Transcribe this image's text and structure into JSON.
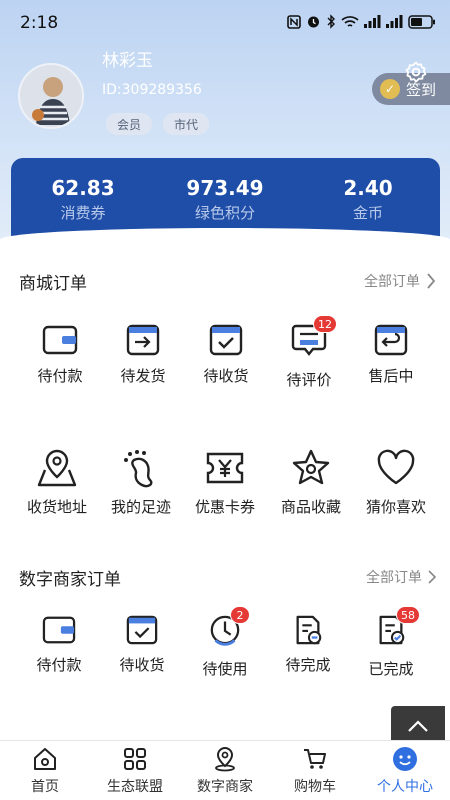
{
  "status_bar": {
    "time": "2:18"
  },
  "profile": {
    "name": "林彩玉",
    "id_text": "ID:309289356",
    "tags": [
      "会员",
      "市代"
    ],
    "signin_label": "签到"
  },
  "stats": [
    {
      "value": "62.83",
      "label": "消费券"
    },
    {
      "value": "973.49",
      "label": "绿色积分"
    },
    {
      "value": "2.40",
      "label": "金币"
    }
  ],
  "mall_orders": {
    "title": "商城订单",
    "more_label": "全部订单",
    "items": [
      {
        "label": "待付款",
        "icon": "wallet-icon"
      },
      {
        "label": "待发货",
        "icon": "ship-box-icon"
      },
      {
        "label": "待收货",
        "icon": "receive-box-icon"
      },
      {
        "label": "待评价",
        "icon": "comment-icon",
        "badge": "12"
      },
      {
        "label": "售后中",
        "icon": "return-box-icon"
      }
    ]
  },
  "services": {
    "items": [
      {
        "label": "收货地址",
        "icon": "map-pin-icon"
      },
      {
        "label": "我的足迹",
        "icon": "footprint-icon"
      },
      {
        "label": "优惠卡券",
        "icon": "coupon-icon"
      },
      {
        "label": "商品收藏",
        "icon": "star-icon"
      },
      {
        "label": "猜你喜欢",
        "icon": "heart-icon"
      }
    ]
  },
  "merchant_orders": {
    "title": "数字商家订单",
    "more_label": "全部订单",
    "items": [
      {
        "label": "待付款",
        "icon": "wallet-icon"
      },
      {
        "label": "待收货",
        "icon": "receive-box-icon"
      },
      {
        "label": "待使用",
        "icon": "clock-icon",
        "badge": "2"
      },
      {
        "label": "待完成",
        "icon": "doc-pending-icon"
      },
      {
        "label": "已完成",
        "icon": "doc-done-icon",
        "badge": "58"
      }
    ]
  },
  "tab_bar": {
    "items": [
      {
        "label": "首页",
        "icon": "home-icon"
      },
      {
        "label": "生态联盟",
        "icon": "grid-icon"
      },
      {
        "label": "数字商家",
        "icon": "location-icon"
      },
      {
        "label": "购物车",
        "icon": "cart-icon"
      },
      {
        "label": "个人中心",
        "icon": "profile-icon",
        "active": true
      }
    ]
  },
  "colors": {
    "accent": "#2f6fe0",
    "stats_bg": "#1f4ea8",
    "badge": "#e53935"
  }
}
